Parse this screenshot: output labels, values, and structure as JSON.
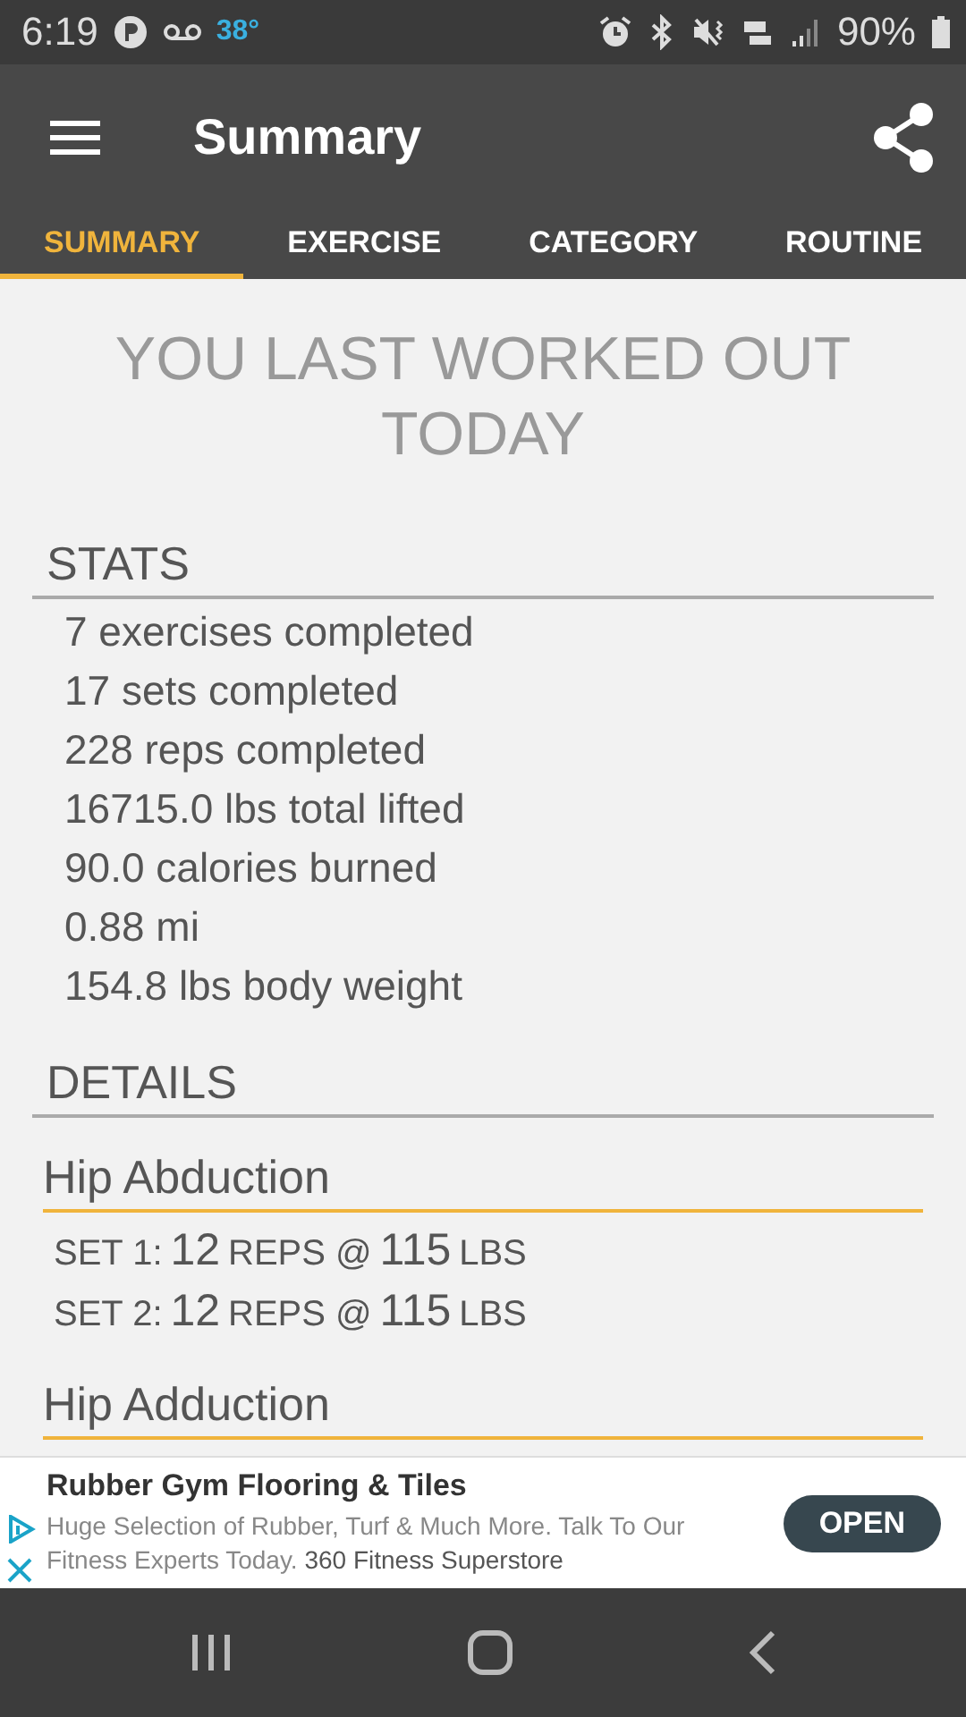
{
  "status_bar": {
    "time": "6:19",
    "temperature": "38°",
    "battery": "90%"
  },
  "app_bar": {
    "title": "Summary"
  },
  "tabs": [
    {
      "label": "SUMMARY",
      "selected": true
    },
    {
      "label": "EXERCISE",
      "selected": false
    },
    {
      "label": "CATEGORY",
      "selected": false
    },
    {
      "label": "ROUTINE",
      "selected": false
    }
  ],
  "headline": "YOU LAST WORKED OUT TODAY",
  "stats": {
    "heading": "STATS",
    "lines": [
      "7 exercises completed",
      "17 sets completed",
      "228 reps completed",
      "16715.0 lbs total lifted",
      "90.0 calories burned",
      "0.88 mi",
      "154.8 lbs body weight"
    ]
  },
  "details": {
    "heading": "DETAILS",
    "exercises": [
      {
        "name": "Hip Abduction",
        "sets": [
          {
            "label": "SET 1:",
            "reps": "12",
            "reps_unit": "REPS @",
            "weight": "115",
            "weight_unit": "LBS"
          },
          {
            "label": "SET 2:",
            "reps": "12",
            "reps_unit": "REPS @",
            "weight": "115",
            "weight_unit": "LBS"
          }
        ]
      },
      {
        "name": "Hip Adduction"
      }
    ]
  },
  "ad": {
    "title": "Rubber Gym Flooring & Tiles",
    "description": "Huge Selection of Rubber, Turf & Much More. Talk To Our Fitness Experts Today.",
    "advertiser": "360 Fitness Superstore",
    "button": "OPEN"
  }
}
